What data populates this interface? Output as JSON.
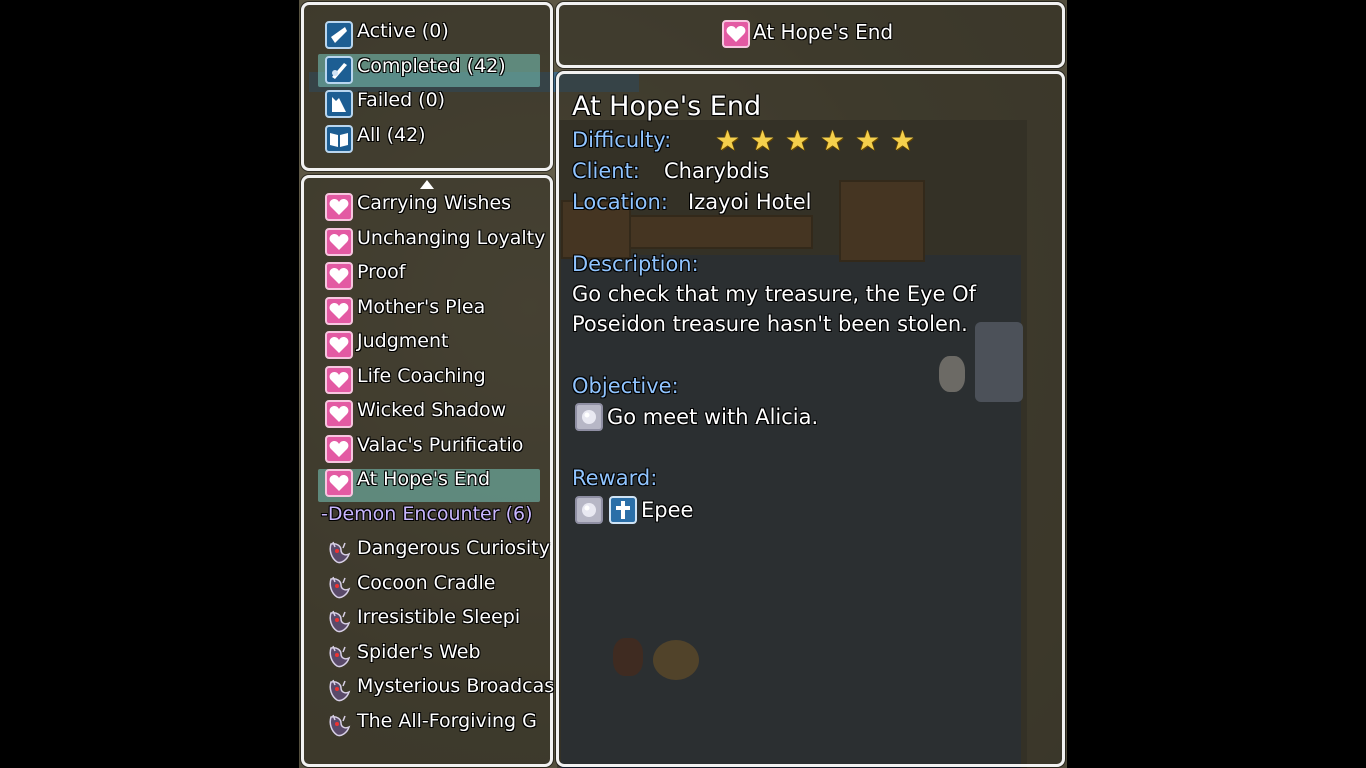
{
  "categories": [
    {
      "label": "Active (0)",
      "icon": "quest-scroll-icon"
    },
    {
      "label": "Completed (42)",
      "icon": "quill-icon"
    },
    {
      "label": "Failed (0)",
      "icon": "broken-icon"
    },
    {
      "label": "All (42)",
      "icon": "book-icon"
    }
  ],
  "selected_category": "Completed (42)",
  "quests": [
    {
      "label": "Carrying Wishes",
      "icon": "heart-icon"
    },
    {
      "label": "Unchanging Loyalty",
      "icon": "heart-icon"
    },
    {
      "label": "Proof",
      "icon": "heart-icon"
    },
    {
      "label": "Mother's Plea",
      "icon": "heart-icon"
    },
    {
      "label": "Judgment",
      "icon": "heart-icon"
    },
    {
      "label": "Life Coaching",
      "icon": "heart-icon"
    },
    {
      "label": "Wicked Shadow",
      "icon": "heart-icon"
    },
    {
      "label": "Valac's Purificatio",
      "icon": "heart-icon"
    },
    {
      "label": "At Hope's End",
      "icon": "heart-icon"
    }
  ],
  "group_header": "-Demon Encounter (6)",
  "demon_quests": [
    {
      "label": "Dangerous Curiosity",
      "icon": "demon-icon"
    },
    {
      "label": "Cocoon Cradle",
      "icon": "demon-icon"
    },
    {
      "label": "Irresistible Sleepi",
      "icon": "demon-icon"
    },
    {
      "label": "Spider's Web",
      "icon": "demon-icon"
    },
    {
      "label": "Mysterious Broadcas",
      "icon": "demon-icon"
    },
    {
      "label": "The All-Forgiving G",
      "icon": "demon-icon"
    }
  ],
  "selected_quest": "At Hope's End",
  "title_bar": {
    "label": "At Hope's End",
    "icon": "heart-icon"
  },
  "detail": {
    "title": "At Hope's End",
    "difficulty_label": "Difficulty:",
    "difficulty_stars": 6,
    "client_label": "Client:",
    "client": "Charybdis",
    "location_label": "Location:",
    "location": "Izayoi Hotel",
    "description_label": "Description:",
    "description_line1": "Go check that my treasure, the Eye Of",
    "description_line2": "Poseidon treasure hasn't been stolen.",
    "objective_label": "Objective:",
    "objective": "Go meet with Alicia.",
    "reward_label": "Reward:",
    "reward": "Epee"
  },
  "colors": {
    "system_text": "#90c4ff",
    "heart_icon": "#e35aa3",
    "selection": "#78c8be",
    "window_border": "#f2f2f2",
    "star": "#f5d04c"
  }
}
